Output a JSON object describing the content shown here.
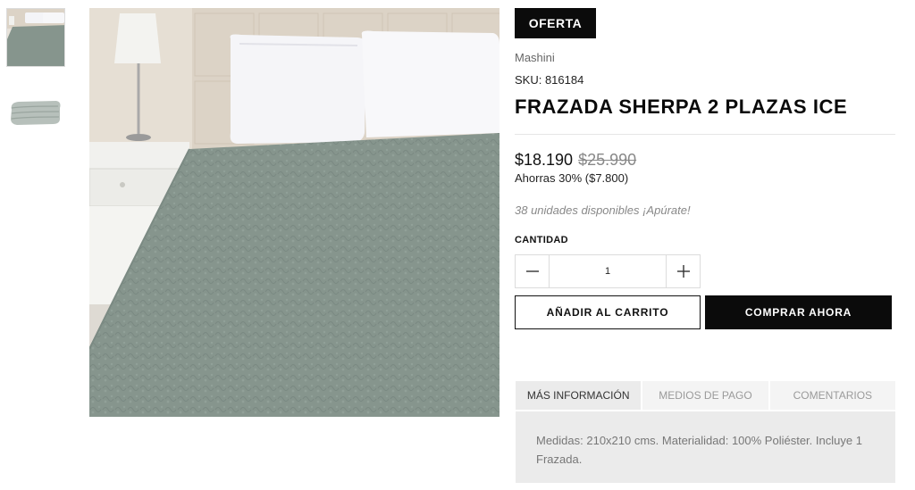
{
  "gallery": {
    "thumbnails": [
      "blanket-on-bed",
      "folded-blanket"
    ],
    "main_image": "blanket-on-bed",
    "colors": {
      "blanket": "#86958d",
      "wall": "#dcd3c6",
      "pillow": "#f4f4f7",
      "nightstand": "#f1f1ee"
    }
  },
  "product": {
    "badge": "OFERTA",
    "brand": "Mashini",
    "sku": "SKU: 816184",
    "title": "FRAZADA SHERPA 2 PLAZAS ICE",
    "price": "$18.190",
    "old_price": "$25.990",
    "savings": "Ahorras 30% ($7.800)",
    "stock": "38 unidades disponibles ¡Apúrate!"
  },
  "quantity": {
    "label": "CANTIDAD",
    "value": "1"
  },
  "actions": {
    "add_to_cart": "AÑADIR AL CARRITO",
    "buy_now": "COMPRAR AHORA"
  },
  "tabs": [
    {
      "label": "MÁS INFORMACIÓN",
      "active": true
    },
    {
      "label": "MEDIOS DE PAGO",
      "active": false
    },
    {
      "label": "COMENTARIOS",
      "active": false
    }
  ],
  "tab_content": "Medidas: 210x210 cms. Materialidad: 100% Poliéster. Incluye 1 Frazada.",
  "colors": {
    "accent": "#0b0b0b",
    "old_price": "#888888",
    "tab_bg": "#ebebeb"
  }
}
